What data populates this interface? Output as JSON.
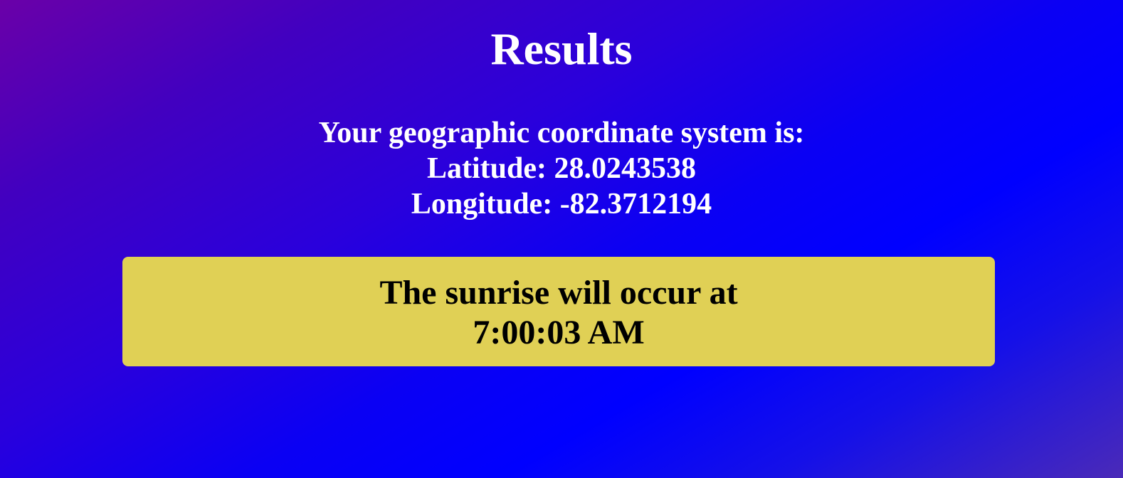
{
  "page": {
    "title": "Results"
  },
  "coordinates": {
    "heading": "Your geographic coordinate system is:",
    "latitude_label": "Latitude:",
    "latitude_value": "28.0243538",
    "longitude_label": "Longitude:",
    "longitude_value": "-82.3712194"
  },
  "sunrise": {
    "message": "The sunrise will occur at",
    "time": "7:00:03 AM",
    "box_color": "#e0d055"
  },
  "colors": {
    "gradient_start": "#6a00a8",
    "gradient_mid": "#0000ff",
    "gradient_end": "#4a2ab8",
    "text_primary": "#ffffff",
    "text_box": "#000000"
  }
}
